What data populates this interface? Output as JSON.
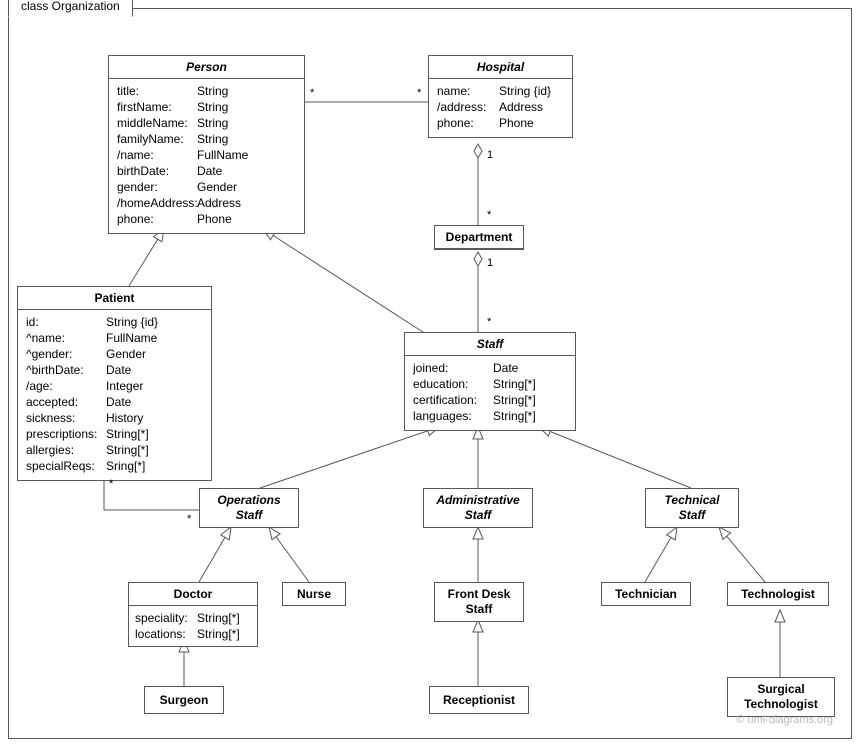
{
  "frame": {
    "title": "class Organization"
  },
  "classes": {
    "person": {
      "title": "Person",
      "attrs": [
        {
          "k": "title:",
          "v": "String"
        },
        {
          "k": "firstName:",
          "v": "String"
        },
        {
          "k": "middleName:",
          "v": "String"
        },
        {
          "k": "familyName:",
          "v": "String"
        },
        {
          "k": "/name:",
          "v": "FullName"
        },
        {
          "k": "birthDate:",
          "v": "Date"
        },
        {
          "k": "gender:",
          "v": "Gender"
        },
        {
          "k": "/homeAddress:",
          "v": "Address"
        },
        {
          "k": "phone:",
          "v": "Phone"
        }
      ]
    },
    "hospital": {
      "title": "Hospital",
      "attrs": [
        {
          "k": "name:",
          "v": "String {id}"
        },
        {
          "k": "/address:",
          "v": "Address"
        },
        {
          "k": "phone:",
          "v": "Phone"
        }
      ]
    },
    "department": {
      "title": "Department"
    },
    "patient": {
      "title": "Patient",
      "attrs": [
        {
          "k": "id:",
          "v": "String {id}"
        },
        {
          "k": "^name:",
          "v": "FullName"
        },
        {
          "k": "^gender:",
          "v": "Gender"
        },
        {
          "k": "^birthDate:",
          "v": "Date"
        },
        {
          "k": "/age:",
          "v": "Integer"
        },
        {
          "k": "accepted:",
          "v": "Date"
        },
        {
          "k": "sickness:",
          "v": "History"
        },
        {
          "k": "prescriptions:",
          "v": "String[*]"
        },
        {
          "k": "allergies:",
          "v": "String[*]"
        },
        {
          "k": "specialReqs:",
          "v": "Sring[*]"
        }
      ]
    },
    "staff": {
      "title": "Staff",
      "attrs": [
        {
          "k": "joined:",
          "v": "Date"
        },
        {
          "k": "education:",
          "v": "String[*]"
        },
        {
          "k": "certification:",
          "v": "String[*]"
        },
        {
          "k": "languages:",
          "v": "String[*]"
        }
      ]
    },
    "operations_staff": {
      "title": "Operations Staff"
    },
    "administrative_staff": {
      "title": "Administrative Staff"
    },
    "technical_staff": {
      "title": "Technical Staff"
    },
    "doctor": {
      "title": "Doctor",
      "attrs": [
        {
          "k": "speciality:",
          "v": "String[*]"
        },
        {
          "k": "locations:",
          "v": "String[*]"
        }
      ]
    },
    "nurse": {
      "title": "Nurse"
    },
    "front_desk_staff": {
      "title": "Front Desk Staff"
    },
    "technician": {
      "title": "Technician"
    },
    "technologist": {
      "title": "Technologist"
    },
    "surgeon": {
      "title": "Surgeon"
    },
    "receptionist": {
      "title": "Receptionist"
    },
    "surgical_technologist": {
      "title": "Surgical Technologist"
    }
  },
  "mults": {
    "person_hospital_left": "*",
    "person_hospital_right": "*",
    "hospital_dept_top": "1",
    "hospital_dept_bottom": "*",
    "dept_staff_top": "1",
    "dept_staff_bottom": "*",
    "patient_ops_left": "*",
    "patient_ops_right": "*"
  },
  "watermark": "© uml-diagrams.org"
}
